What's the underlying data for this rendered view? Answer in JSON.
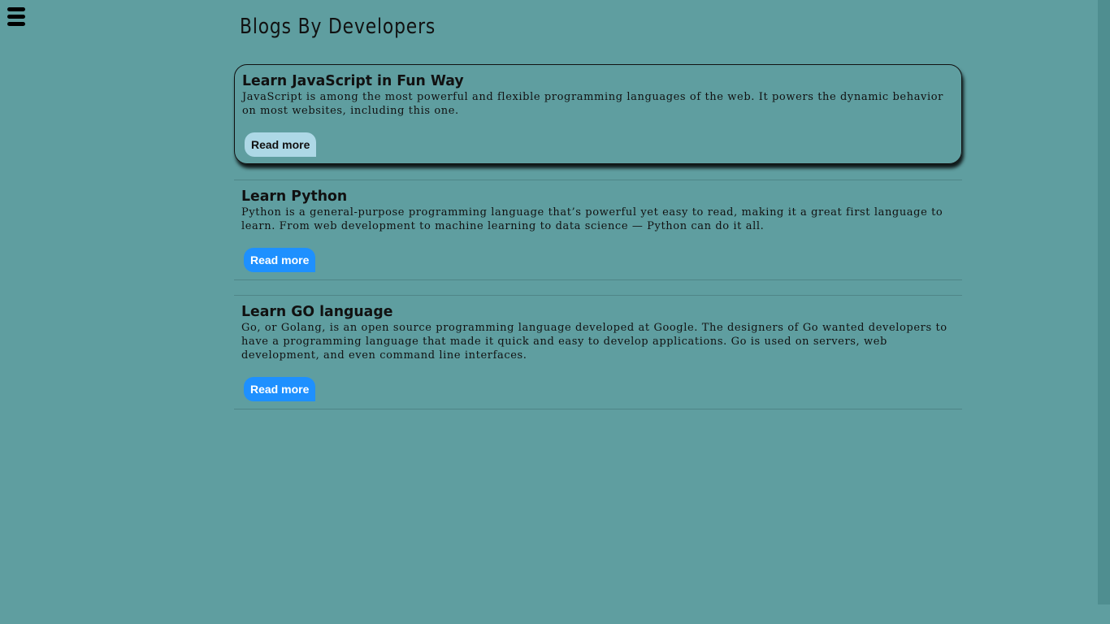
{
  "page": {
    "title": "Blogs By Developers"
  },
  "menu": {
    "icon": "hamburger-menu-icon"
  },
  "posts": [
    {
      "title": "Learn JavaScript in Fun Way",
      "text": "JavaScript is among the most powerful and flexible programming languages of the web. It powers the dynamic behavior on most websites, including this one.",
      "button_label": "Read more"
    },
    {
      "title": "Learn Python",
      "text": "Python is a general-purpose programming language that’s powerful yet easy to read, making it a great first language to learn. From web development to machine learning to data science — Python can do it all.",
      "button_label": "Read more"
    },
    {
      "title": "Learn GO language",
      "text": "Go, or Golang, is an open source programming language developed at Google. The designers of Go wanted developers to have a programming language that made it quick and easy to develop applications. Go is used on servers, web development, and even command line interfaces.",
      "button_label": "Read more"
    }
  ],
  "colors": {
    "background": "#5f9ea0",
    "active_button": "#add8e6",
    "button": "#1e90ff"
  }
}
